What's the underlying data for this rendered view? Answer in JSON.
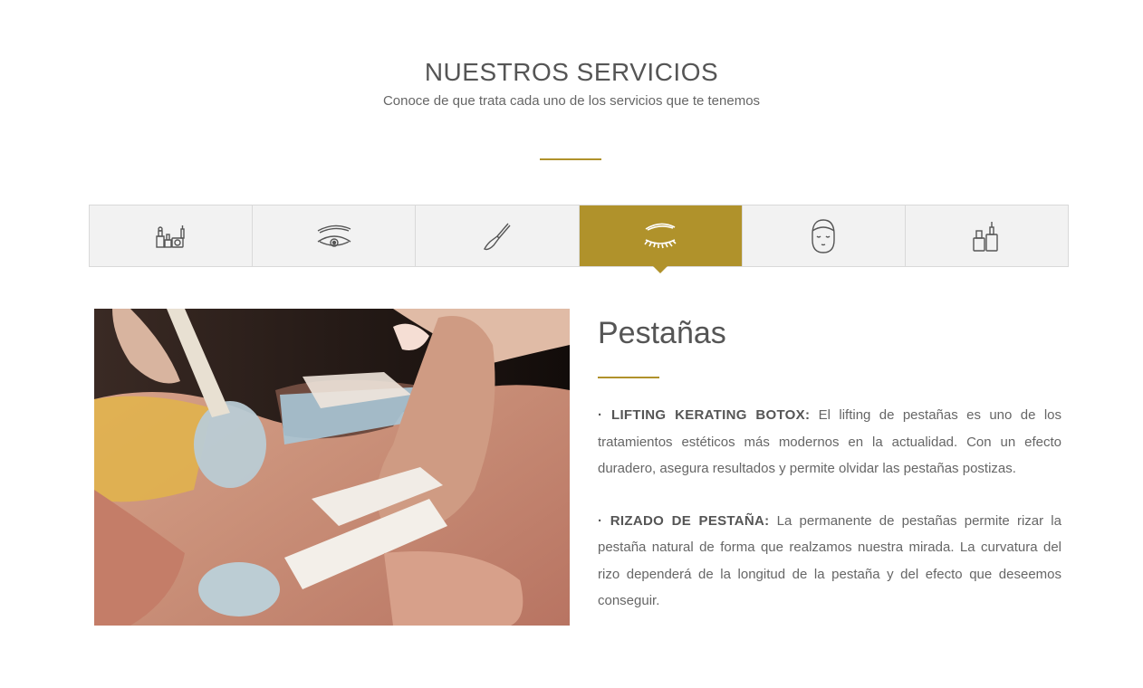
{
  "header": {
    "title": "NUESTROS SERVICIOS",
    "subtitle": "Conoce de que trata cada uno de los servicios que te tenemos"
  },
  "tabs": [
    {
      "icon": "makeup-kit-icon",
      "active": false
    },
    {
      "icon": "eyebrow-eye-icon",
      "active": false
    },
    {
      "icon": "makeup-brush-icon",
      "active": false
    },
    {
      "icon": "eyelash-icon",
      "active": true
    },
    {
      "icon": "face-mask-icon",
      "active": false
    },
    {
      "icon": "nail-polish-icon",
      "active": false
    }
  ],
  "service": {
    "title": "Pestañas",
    "image": "eyelash-lifting-treatment-photo",
    "items": [
      {
        "label": "· LIFTING KERATING BOTOX:",
        "text": " El lifting de pestañas es uno de los tratamientos estéticos más modernos en la actualidad. Con un efecto duradero, asegura resultados y permite olvidar las pestañas postizas."
      },
      {
        "label": "· RIZADO DE PESTAÑA:",
        "text": " La permanente de pestañas permite rizar la pestaña natural de forma que realzamos nuestra mirada. La curvatura del rizo dependerá de la longitud de la pestaña y del efecto que deseemos conseguir."
      }
    ]
  },
  "colors": {
    "accent": "#b0922b",
    "text": "#555555",
    "tab_bg": "#f2f2f2",
    "tab_border": "#d9d9d9"
  }
}
